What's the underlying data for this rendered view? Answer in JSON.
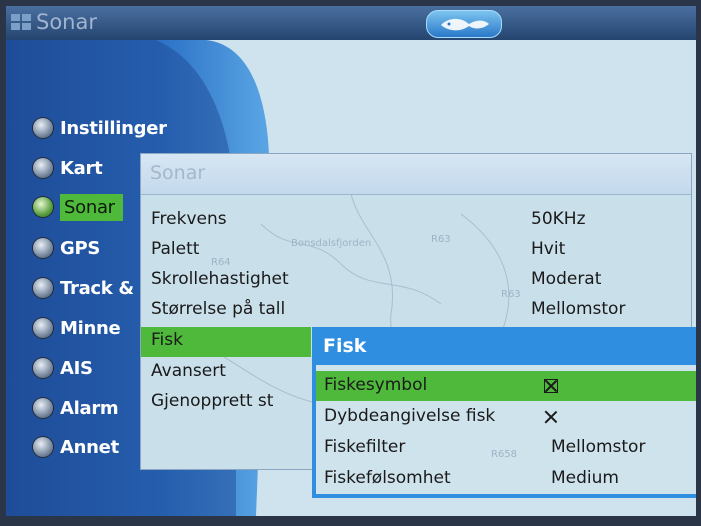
{
  "window": {
    "title": "Sonar"
  },
  "sidebar": {
    "items": [
      {
        "label": "Instillinger",
        "icon": "gear-icon"
      },
      {
        "label": "Kart",
        "icon": "globe-icon"
      },
      {
        "label": "Sonar",
        "icon": "sonar-icon",
        "selected": true
      },
      {
        "label": "GPS",
        "icon": "satellite-icon"
      },
      {
        "label": "Track &",
        "icon": "track-icon"
      },
      {
        "label": "Minne",
        "icon": "memory-icon"
      },
      {
        "label": "AIS",
        "icon": "ship-icon"
      },
      {
        "label": "Alarm",
        "icon": "alarm-icon"
      },
      {
        "label": "Annet",
        "icon": "other-icon"
      }
    ]
  },
  "sonar_panel": {
    "title": "Sonar",
    "rows": [
      {
        "name": "Frekvens",
        "value": "50KHz"
      },
      {
        "name": "Palett",
        "value": "Hvit"
      },
      {
        "name": "Skrollehastighet",
        "value": "Moderat"
      },
      {
        "name": "Størrelse på tall",
        "value": "Mellomstor"
      },
      {
        "name": "Fisk",
        "value": "",
        "selected": true
      },
      {
        "name": "Avansert",
        "value": ""
      },
      {
        "name": "Gjenopprett st",
        "value": ""
      }
    ]
  },
  "fisk_panel": {
    "title": "Fisk",
    "rows": [
      {
        "name": "Fiskesymbol",
        "checked": true,
        "selected": true
      },
      {
        "name": "Dybdeangivelse fisk",
        "checked": true
      },
      {
        "name": "Fiskefilter",
        "value": "Mellomstor"
      },
      {
        "name": "Fiskefølsomhet",
        "value": "Medium"
      }
    ]
  },
  "map_labels": [
    "R64",
    "Bonsdalsfjorden",
    "R63",
    "R63",
    "R658"
  ],
  "colors": {
    "accent_green": "#4eb93a",
    "accent_blue": "#2f8ee0"
  }
}
